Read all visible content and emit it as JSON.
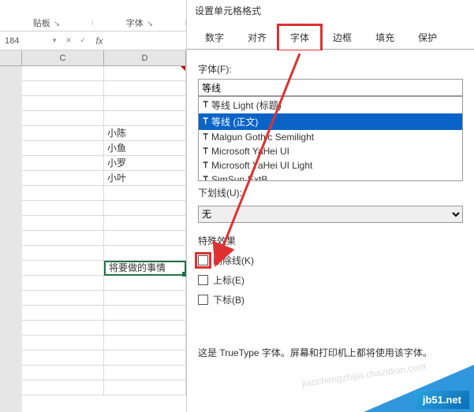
{
  "ribbon": {
    "clipboard_label": "贴板",
    "font_group_label": "字体"
  },
  "namebox": {
    "value": "184"
  },
  "columns": [
    "C",
    "D"
  ],
  "cells_d": [
    "",
    "",
    "",
    "",
    "小陈",
    "小鱼",
    "小罗",
    "小叶"
  ],
  "editing_cell": {
    "value": "将要做的事情"
  },
  "dialog": {
    "title": "设置单元格格式",
    "tabs": [
      "数字",
      "对齐",
      "字体",
      "边框",
      "填充",
      "保护"
    ],
    "active_tab": "字体",
    "font_label": "字体(F):",
    "font_value": "等线",
    "font_options": [
      "等线 Light (标题)",
      "等线 (正文)",
      "Malgun Gothic Semilight",
      "Microsoft YaHei UI",
      "Microsoft YaHei UI Light",
      "SimSun-ExtB"
    ],
    "underline_label": "下划线(U):",
    "underline_value": "无",
    "effects_label": "特殊效果",
    "strike_label": "删除线(K)",
    "super_label": "上标(E)",
    "sub_label": "下标(B)",
    "preview_note": "这是 TrueType 字体。屏幕和打印机上都将使用该字体。"
  },
  "watermarks": {
    "faint": "jiaochengzhijia.chazidian.com",
    "bold": "jb51.net"
  }
}
